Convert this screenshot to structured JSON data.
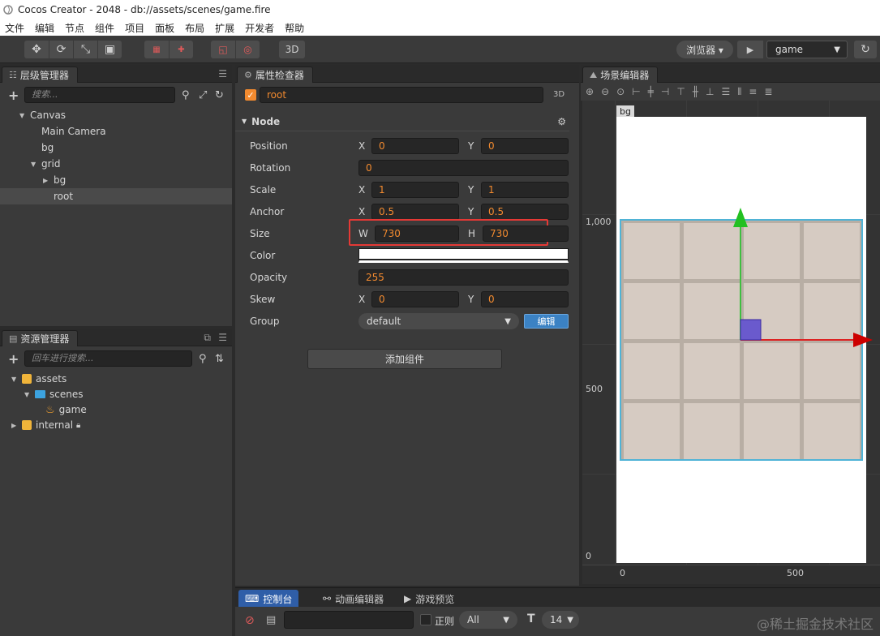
{
  "window": {
    "title": "Cocos Creator - 2048 - db://assets/scenes/game.fire"
  },
  "menu": [
    "文件",
    "编辑",
    "节点",
    "组件",
    "项目",
    "面板",
    "布局",
    "扩展",
    "开发者",
    "帮助"
  ],
  "toolbar": {
    "mode_3d": "3D",
    "browser": "浏览器 ▾",
    "scene": "game"
  },
  "hierarchy": {
    "tab": "层级管理器",
    "search_placeholder": "搜索...",
    "items": [
      {
        "label": "Canvas",
        "depth": 1,
        "expanded": true
      },
      {
        "label": "Main Camera",
        "depth": 2
      },
      {
        "label": "bg",
        "depth": 2
      },
      {
        "label": "grid",
        "depth": 2,
        "expanded": true
      },
      {
        "label": "bg",
        "depth": 3,
        "collapsed": true
      },
      {
        "label": "root",
        "depth": 3,
        "selected": true
      }
    ]
  },
  "assets": {
    "tab": "资源管理器",
    "search_placeholder": "回车进行搜索...",
    "items": [
      {
        "label": "assets"
      },
      {
        "label": "scenes"
      },
      {
        "label": "game"
      },
      {
        "label": "internal"
      }
    ]
  },
  "inspector": {
    "tab": "属性检查器",
    "node_name": "root",
    "badge_3d": "3D",
    "section": "Node",
    "position": {
      "label": "Position",
      "x": "0",
      "y": "0"
    },
    "rotation": {
      "label": "Rotation",
      "value": "0"
    },
    "scale": {
      "label": "Scale",
      "x": "1",
      "y": "1"
    },
    "anchor": {
      "label": "Anchor",
      "x": "0.5",
      "y": "0.5"
    },
    "size": {
      "label": "Size",
      "w": "730",
      "h": "730"
    },
    "color": {
      "label": "Color",
      "value": "#ffffff"
    },
    "opacity": {
      "label": "Opacity",
      "value": "255"
    },
    "skew": {
      "label": "Skew",
      "x": "0",
      "y": "0"
    },
    "group": {
      "label": "Group",
      "value": "default",
      "edit_button": "编辑"
    },
    "add_component": "添加组件",
    "axis_labels": {
      "x": "X",
      "y": "Y",
      "w": "W",
      "h": "H"
    }
  },
  "scene_editor": {
    "tab": "场景编辑器",
    "node_label": "bg",
    "ruler_v": [
      "1,000",
      "500",
      "0"
    ],
    "ruler_h": [
      "0",
      "500"
    ]
  },
  "bottom": {
    "tabs": [
      "控制台",
      "动画编辑器",
      "游戏预览"
    ],
    "regex_label": "正则",
    "level": "All",
    "font_size": "14"
  },
  "watermark": "@稀土掘金技术社区",
  "colors": {
    "accent_orange": "#f28a2f",
    "highlight_red": "#e53935",
    "active_blue": "#2f5ea8",
    "board_border": "#4fb3d6"
  }
}
